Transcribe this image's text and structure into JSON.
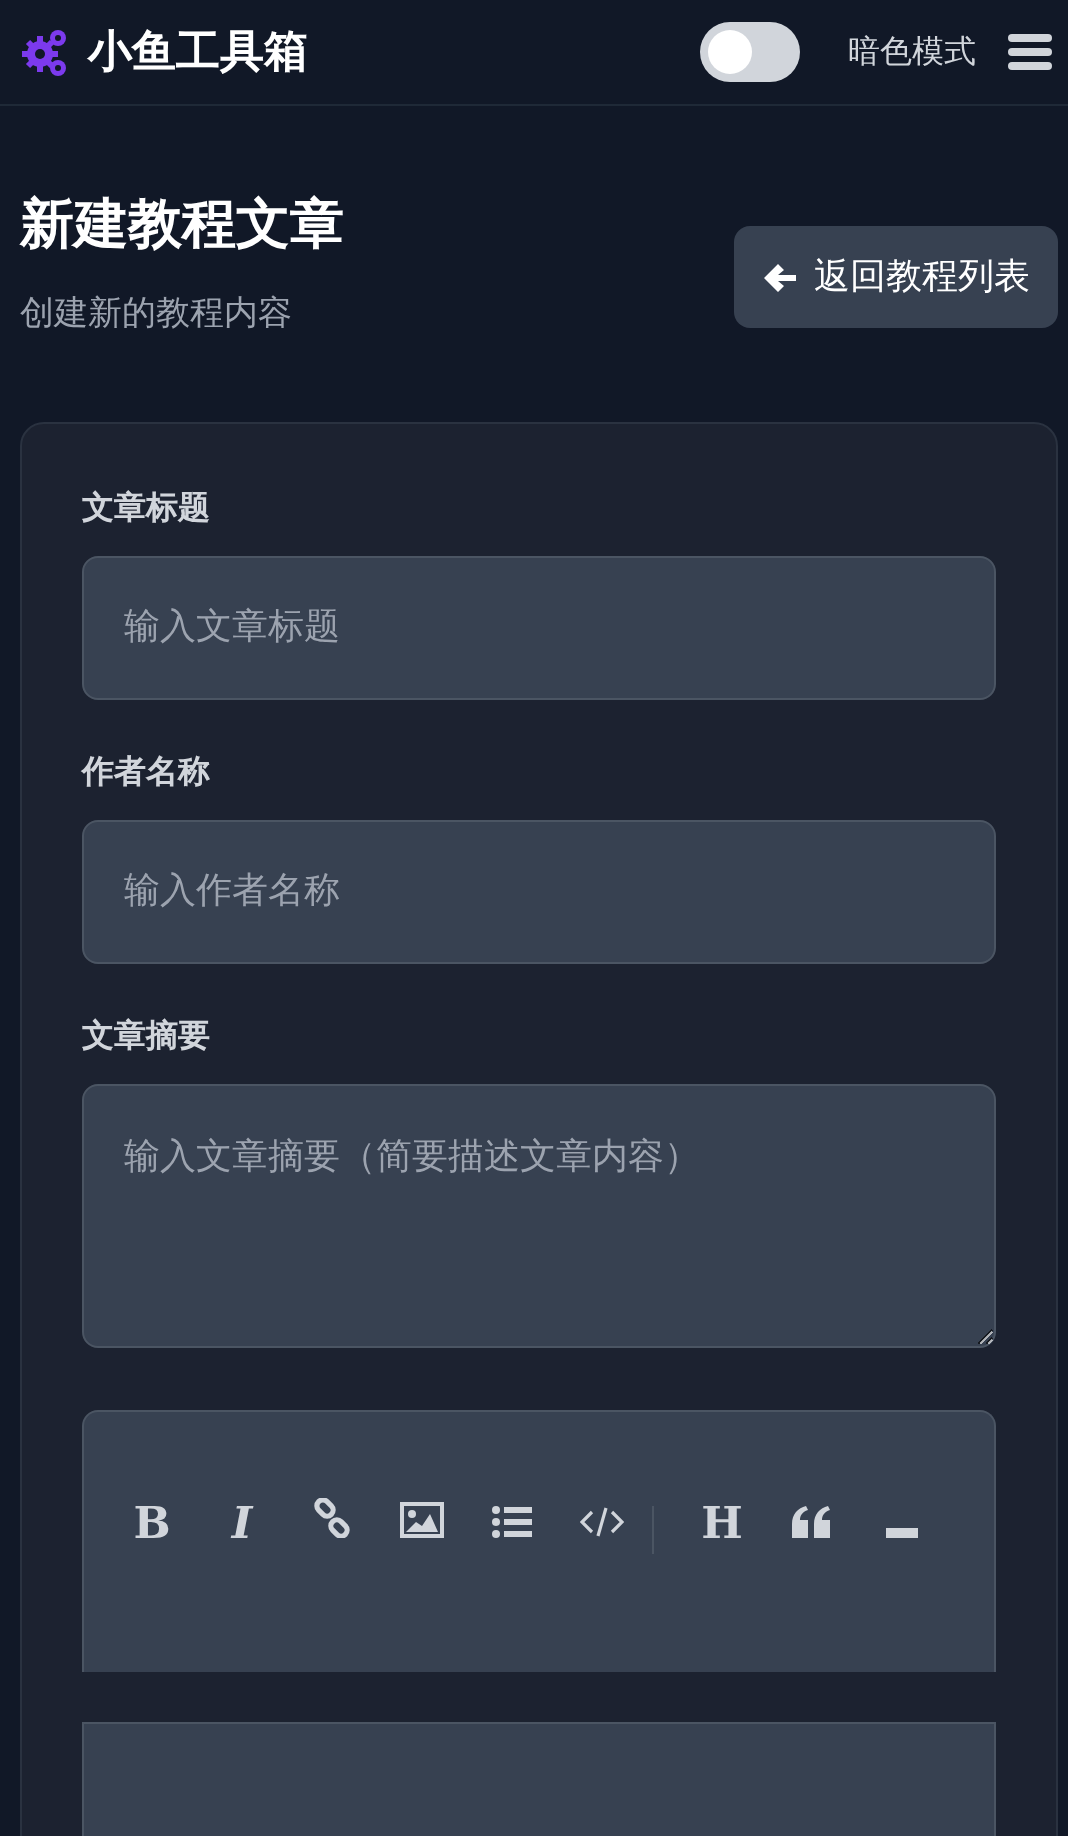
{
  "navbar": {
    "brand": "小鱼工具箱",
    "theme_toggle": {
      "label": "暗色模式",
      "on": false
    }
  },
  "header": {
    "title": "新建教程文章",
    "subtitle": "创建新的教程内容",
    "back_button": "返回教程列表"
  },
  "form": {
    "fields": [
      {
        "label": "文章标题",
        "placeholder": "输入文章标题",
        "kind": "input"
      },
      {
        "label": "作者名称",
        "placeholder": "输入作者名称",
        "kind": "input"
      },
      {
        "label": "文章摘要",
        "placeholder": "输入文章摘要（简要描述文章内容）",
        "kind": "textarea"
      }
    ],
    "editor": {
      "toolbar": [
        {
          "kind": "glyph",
          "label": "B"
        },
        {
          "kind": "glyph",
          "label": "I"
        },
        {
          "kind": "icon"
        },
        {
          "kind": "icon"
        },
        {
          "kind": "icon"
        },
        {
          "kind": "icon"
        },
        {
          "kind": "separator"
        },
        {
          "kind": "glyph",
          "label": "H"
        },
        {
          "kind": "icon"
        },
        {
          "kind": "icon"
        }
      ]
    }
  }
}
